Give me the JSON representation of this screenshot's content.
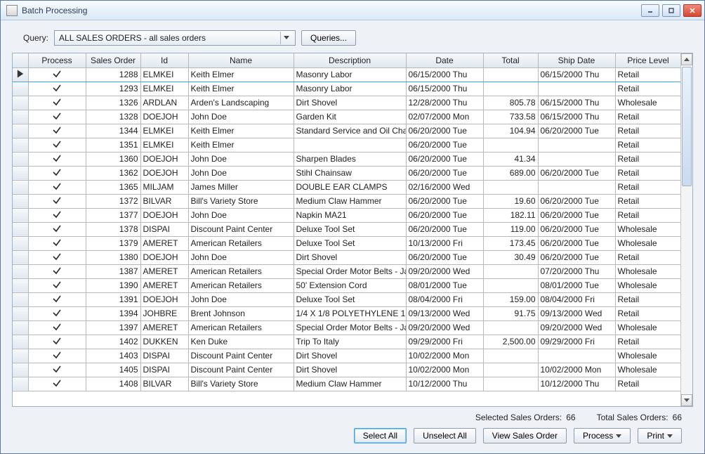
{
  "window": {
    "title": "Batch Processing"
  },
  "query": {
    "label": "Query:",
    "selected": "ALL SALES ORDERS - all sales orders",
    "queries_button": "Queries..."
  },
  "columns": {
    "process": "Process",
    "sales_order": "Sales Order",
    "id": "Id",
    "name": "Name",
    "description": "Description",
    "date": "Date",
    "total": "Total",
    "ship_date": "Ship Date",
    "price_level": "Price Level"
  },
  "rows": [
    {
      "so": "1288",
      "id": "ELMKEI",
      "name": "Keith Elmer",
      "desc": "Masonry Labor",
      "date": "06/15/2000 Thu",
      "total": "",
      "ship": "06/15/2000 Thu",
      "price": "Retail",
      "selected": true
    },
    {
      "so": "1293",
      "id": "ELMKEI",
      "name": "Keith Elmer",
      "desc": "Masonry Labor",
      "date": "06/15/2000 Thu",
      "total": "",
      "ship": "",
      "price": "Retail"
    },
    {
      "so": "1326",
      "id": "ARDLAN",
      "name": "Arden's Landscaping",
      "desc": "Dirt Shovel",
      "date": "12/28/2000 Thu",
      "total": "805.78",
      "ship": "06/15/2000 Thu",
      "price": "Wholesale"
    },
    {
      "so": "1328",
      "id": "DOEJOH",
      "name": "John Doe",
      "desc": "Garden Kit",
      "date": "02/07/2000 Mon",
      "total": "733.58",
      "ship": "06/15/2000 Thu",
      "price": "Retail"
    },
    {
      "so": "1344",
      "id": "ELMKEI",
      "name": "Keith Elmer",
      "desc": "Standard Service and Oil Cha",
      "date": "06/20/2000 Tue",
      "total": "104.94",
      "ship": "06/20/2000 Tue",
      "price": "Retail"
    },
    {
      "so": "1351",
      "id": "ELMKEI",
      "name": "Keith Elmer",
      "desc": "",
      "date": "06/20/2000 Tue",
      "total": "",
      "ship": "",
      "price": "Retail"
    },
    {
      "so": "1360",
      "id": "DOEJOH",
      "name": "John Doe",
      "desc": "Sharpen Blades",
      "date": "06/20/2000 Tue",
      "total": "41.34",
      "ship": "",
      "price": "Retail"
    },
    {
      "so": "1362",
      "id": "DOEJOH",
      "name": "John Doe",
      "desc": "Stihl Chainsaw",
      "date": "06/20/2000 Tue",
      "total": "689.00",
      "ship": "06/20/2000 Tue",
      "price": "Retail"
    },
    {
      "so": "1365",
      "id": "MILJAM",
      "name": "James Miller",
      "desc": "DOUBLE EAR CLAMPS",
      "date": "02/16/2000 Wed",
      "total": "",
      "ship": "",
      "price": "Retail"
    },
    {
      "so": "1372",
      "id": "BILVAR",
      "name": "Bill's Variety Store",
      "desc": "Medium Claw Hammer",
      "date": "06/20/2000 Tue",
      "total": "19.60",
      "ship": "06/20/2000 Tue",
      "price": "Retail"
    },
    {
      "so": "1377",
      "id": "DOEJOH",
      "name": "John Doe",
      "desc": "Napkin  MA21",
      "date": "06/20/2000 Tue",
      "total": "182.11",
      "ship": "06/20/2000 Tue",
      "price": "Retail"
    },
    {
      "so": "1378",
      "id": "DISPAI",
      "name": "Discount Paint Center",
      "desc": "Deluxe Tool Set",
      "date": "06/20/2000 Tue",
      "total": "119.00",
      "ship": "06/20/2000 Tue",
      "price": "Wholesale"
    },
    {
      "so": "1379",
      "id": "AMERET",
      "name": "American Retailers",
      "desc": "Deluxe Tool Set",
      "date": "10/13/2000 Fri",
      "total": "173.45",
      "ship": "06/20/2000 Tue",
      "price": "Wholesale"
    },
    {
      "so": "1380",
      "id": "DOEJOH",
      "name": "John Doe",
      "desc": "Dirt Shovel",
      "date": "06/20/2000 Tue",
      "total": "30.49",
      "ship": "06/20/2000 Tue",
      "price": "Retail"
    },
    {
      "so": "1387",
      "id": "AMERET",
      "name": "American Retailers",
      "desc": "Special Order Motor Belts  - Ja",
      "date": "09/20/2000 Wed",
      "total": "",
      "ship": "07/20/2000 Thu",
      "price": "Wholesale"
    },
    {
      "so": "1390",
      "id": "AMERET",
      "name": "American Retailers",
      "desc": "50' Extension Cord",
      "date": "08/01/2000 Tue",
      "total": "",
      "ship": "08/01/2000 Tue",
      "price": "Wholesale"
    },
    {
      "so": "1391",
      "id": "DOEJOH",
      "name": "John Doe",
      "desc": "Deluxe Tool Set",
      "date": "08/04/2000 Fri",
      "total": "159.00",
      "ship": "08/04/2000 Fri",
      "price": "Retail"
    },
    {
      "so": "1394",
      "id": "JOHBRE",
      "name": "Brent Johnson",
      "desc": "1/4 X 1/8 POLYETHYLENE 1",
      "date": "09/13/2000 Wed",
      "total": "91.75",
      "ship": "09/13/2000 Wed",
      "price": "Retail"
    },
    {
      "so": "1397",
      "id": "AMERET",
      "name": "American Retailers",
      "desc": "Special Order Motor Belts  - Ja",
      "date": "09/20/2000 Wed",
      "total": "",
      "ship": "09/20/2000 Wed",
      "price": "Wholesale"
    },
    {
      "so": "1402",
      "id": "DUKKEN",
      "name": "Ken Duke",
      "desc": "Trip To Italy",
      "date": "09/29/2000 Fri",
      "total": "2,500.00",
      "ship": "09/29/2000 Fri",
      "price": "Retail"
    },
    {
      "so": "1403",
      "id": "DISPAI",
      "name": "Discount Paint Center",
      "desc": "Dirt Shovel",
      "date": "10/02/2000 Mon",
      "total": "",
      "ship": "",
      "price": "Wholesale"
    },
    {
      "so": "1405",
      "id": "DISPAI",
      "name": "Discount Paint Center",
      "desc": "Dirt Shovel",
      "date": "10/02/2000 Mon",
      "total": "",
      "ship": "10/02/2000 Mon",
      "price": "Wholesale"
    },
    {
      "so": "1408",
      "id": "BILVAR",
      "name": "Bill's Variety Store",
      "desc": "Medium Claw Hammer",
      "date": "10/12/2000 Thu",
      "total": "",
      "ship": "10/12/2000 Thu",
      "price": "Retail"
    }
  ],
  "status": {
    "selected_label": "Selected Sales Orders:",
    "selected_value": "66",
    "total_label": "Total Sales Orders:",
    "total_value": "66"
  },
  "buttons": {
    "select_all": "Select All",
    "unselect_all": "Unselect All",
    "view_order": "View Sales Order",
    "process": "Process",
    "print": "Print"
  }
}
